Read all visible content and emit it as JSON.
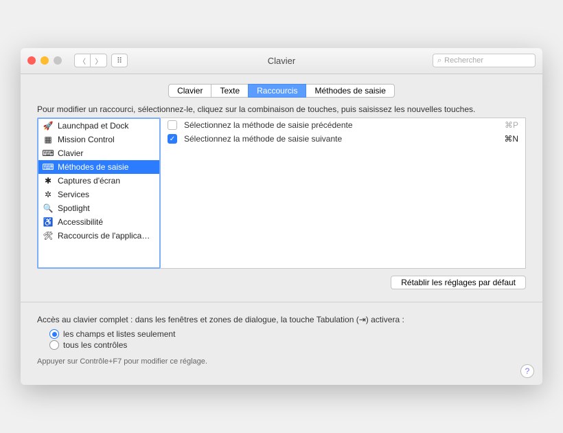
{
  "window": {
    "title": "Clavier"
  },
  "search": {
    "placeholder": "Rechercher"
  },
  "tabs": [
    {
      "label": "Clavier",
      "selected": false
    },
    {
      "label": "Texte",
      "selected": false
    },
    {
      "label": "Raccourcis",
      "selected": true
    },
    {
      "label": "Méthodes de saisie",
      "selected": false
    }
  ],
  "intro": "Pour modifier un raccourci, sélectionnez-le, cliquez sur la combinaison de touches, puis saisissez les nouvelles touches.",
  "categories": [
    {
      "icon": "launchpad",
      "label": "Launchpad et Dock"
    },
    {
      "icon": "mission",
      "label": "Mission Control"
    },
    {
      "icon": "keyboard",
      "label": "Clavier"
    },
    {
      "icon": "input",
      "label": "Méthodes de saisie",
      "selected": true
    },
    {
      "icon": "screenshot",
      "label": "Captures d'écran"
    },
    {
      "icon": "services",
      "label": "Services"
    },
    {
      "icon": "spotlight",
      "label": "Spotlight"
    },
    {
      "icon": "accessibility",
      "label": "Accessibilité"
    },
    {
      "icon": "app",
      "label": "Raccourcis de l'applica…"
    }
  ],
  "shortcuts": [
    {
      "enabled": false,
      "label": "Sélectionnez la méthode de saisie précédente",
      "key": "⌘P"
    },
    {
      "enabled": true,
      "label": "Sélectionnez la méthode de saisie suivante",
      "key": "⌘N"
    }
  ],
  "restore_button": "Rétablir les réglages par défaut",
  "full_access": {
    "label": "Accès au clavier complet : dans les fenêtres et zones de dialogue, la touche Tabulation (⇥) activera :"
  },
  "radios": [
    {
      "label": "les champs et listes seulement",
      "selected": true
    },
    {
      "label": "tous les contrôles",
      "selected": false
    }
  ],
  "hint": "Appuyer sur Contrôle+F7 pour modifier ce réglage.",
  "help": "?"
}
